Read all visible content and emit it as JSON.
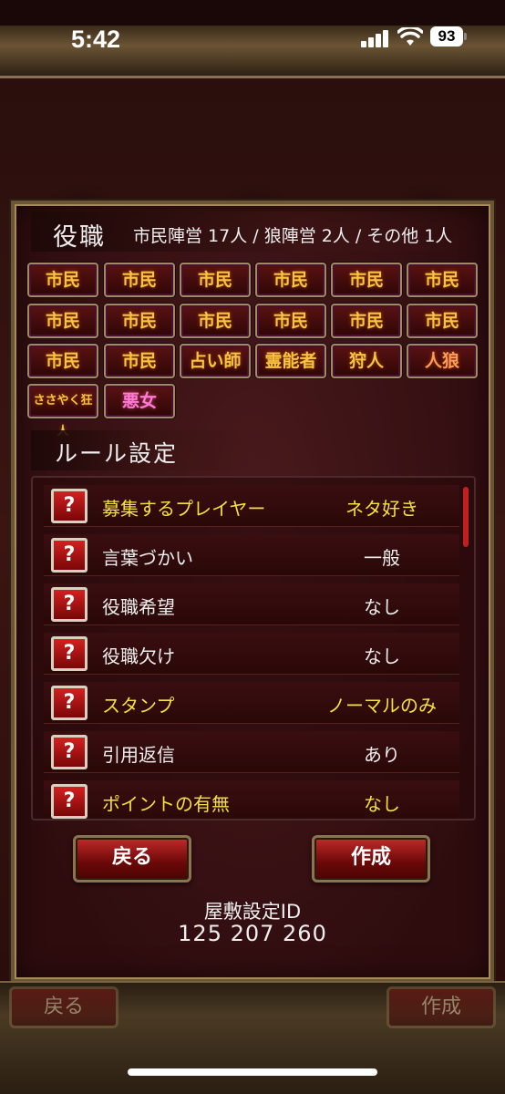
{
  "status": {
    "time": "5:42",
    "battery": "93"
  },
  "roles": {
    "heading": "役職",
    "summary": "市民陣営 17人 / 狼陣営 2人 / その他 1人",
    "chips": [
      "市民",
      "市民",
      "市民",
      "市民",
      "市民",
      "市民",
      "市民",
      "市民",
      "市民",
      "市民",
      "市民",
      "市民",
      "市民",
      "市民",
      "占い師",
      "霊能者",
      "狩人",
      "人狼",
      "ささやく狂人",
      "悪女"
    ]
  },
  "rules": {
    "heading": "ルール設定",
    "help_symbol": "?",
    "items": [
      {
        "name": "募集するプレイヤー",
        "value": "ネタ好き"
      },
      {
        "name": "言葉づかい",
        "value": "一般"
      },
      {
        "name": "役職希望",
        "value": "なし"
      },
      {
        "name": "役職欠け",
        "value": "なし"
      },
      {
        "name": "スタンプ",
        "value": "ノーマルのみ"
      },
      {
        "name": "引用返信",
        "value": "あり"
      },
      {
        "name": "ポイントの有無",
        "value": "なし"
      }
    ]
  },
  "actions": {
    "back_label": "戻る",
    "create_label": "作成"
  },
  "settings_id": {
    "label": "屋敷設定ID",
    "value": "125 207 260"
  },
  "bottom_bar": {
    "back_label": "戻る",
    "create_label": "作成"
  },
  "colors": {
    "highlight": "#f5e040",
    "chip_text": "#f5c440",
    "special_chip": "#ff7ad0"
  }
}
